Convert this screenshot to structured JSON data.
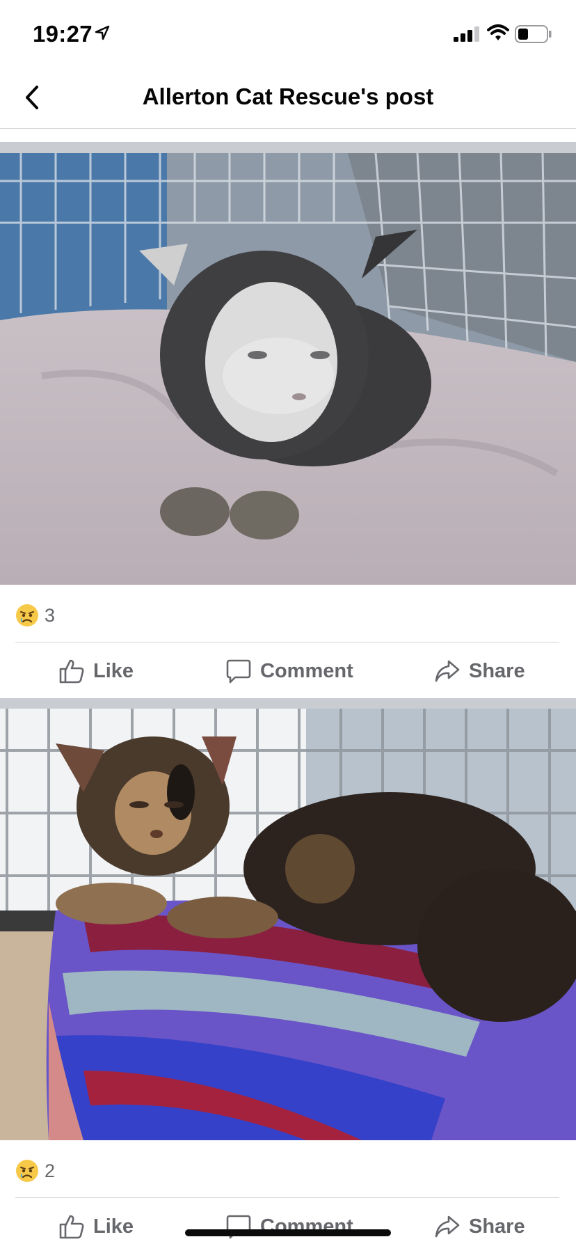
{
  "status_bar": {
    "time": "19:27"
  },
  "nav": {
    "title": "Allerton Cat Rescue's post"
  },
  "posts": [
    {
      "reaction_count": "3",
      "actions": {
        "like": "Like",
        "comment": "Comment",
        "share": "Share"
      }
    },
    {
      "reaction_count": "2",
      "actions": {
        "like": "Like",
        "comment": "Comment",
        "share": "Share"
      }
    }
  ],
  "icons": {
    "back": "chevron-left-icon",
    "reaction": "sad-face-icon",
    "like": "thumbs-up-icon",
    "comment": "speech-bubble-icon",
    "share": "share-arrow-icon"
  },
  "colors": {
    "text": "#050505",
    "secondary": "#65676b",
    "separator": "#c9ccd1",
    "emoji": "#f7c948"
  }
}
